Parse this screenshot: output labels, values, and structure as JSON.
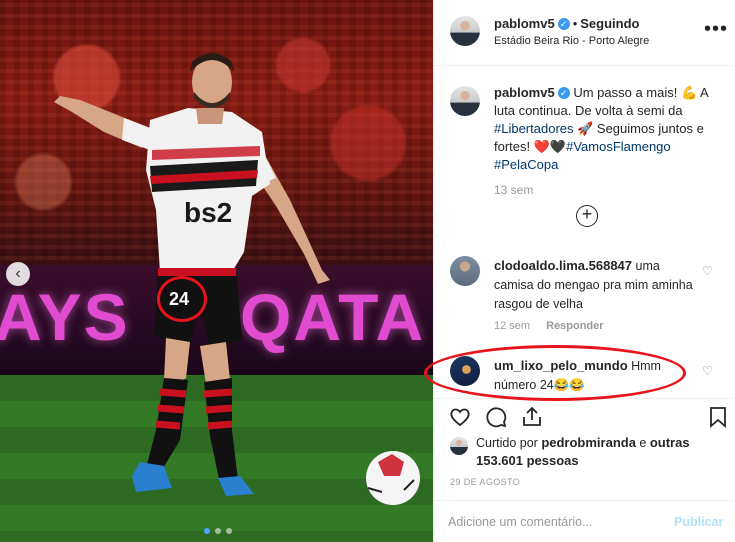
{
  "post": {
    "author": "pablomv5",
    "follow_status": "Seguindo",
    "location": "Estádio Beira Rio - Porto Alegre",
    "caption_parts": {
      "p1": "Um passo a mais! 💪 A luta continua. De volta à semi da ",
      "tag1": "#Libertadores",
      "p2": " 🚀 Seguimos juntos e fortes! ❤️🖤",
      "tag2": "#VamosFlamengo",
      "tag3": "#PelaCopa"
    },
    "caption_time": "13 sem",
    "photo_board_text": [
      "AYS",
      "QATA"
    ],
    "jersey_number": "24",
    "sponsor_text": "bs2"
  },
  "comments": [
    {
      "author": "clodoaldo.lima.568847",
      "text": " uma camisa do mengao pra mim aminha rasgou de velha",
      "time": "12 sem",
      "reply_label": "Responder"
    },
    {
      "author": "um_lixo_pelo_mundo",
      "text": " Hmm número 24😂😂"
    }
  ],
  "likes": {
    "prefix": "Curtido por ",
    "liker": "pedrobmiranda",
    "middle": " e ",
    "others": "outras 153.601 pessoas"
  },
  "date": "29 DE AGOSTO",
  "add_comment": {
    "placeholder": "Adicione um comentário...",
    "publish_label": "Publicar"
  },
  "icons": {
    "more": "•••",
    "plus": "+",
    "heart": "♡",
    "carousel_prev": "‹"
  },
  "colors": {
    "highlight": "#e8141b",
    "link": "#00376b",
    "verified": "#3897f0"
  }
}
